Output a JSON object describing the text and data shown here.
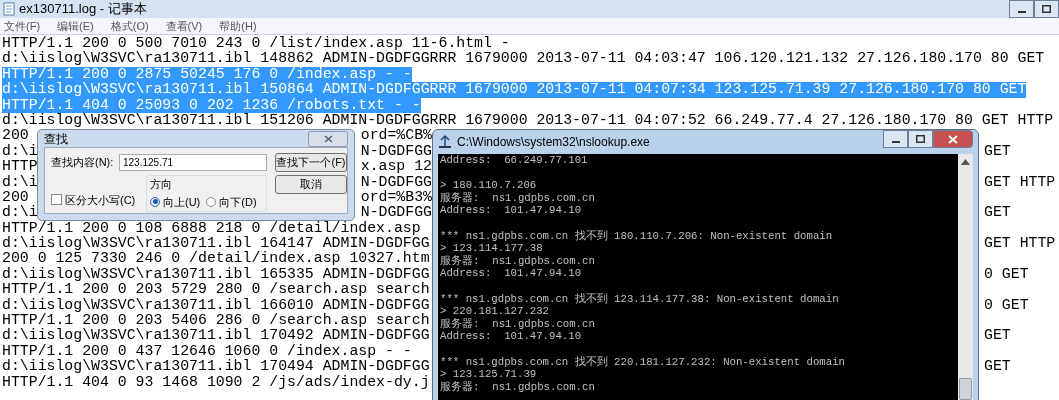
{
  "notepad": {
    "title": "ex130711.log - 记事本",
    "menu": [
      "文件(F)",
      "编辑(E)",
      "格式(O)",
      "查看(V)",
      "帮助(H)"
    ],
    "lines": [
      {
        "text": "HTTP/1.1 200 0 500 7010 243 0 /list/index.asp 11-6.html -",
        "selected": false
      },
      {
        "text": "d:\\iislog\\W3SVC\\ra130711.ibl 148862 ADMIN-DGDFGGRRR 1679000 2013-07-11 04:03:47 106.120.121.132 27.126.180.170 80 GET",
        "selected": false
      },
      {
        "text": "HTTP/1.1 200 0 2875 50245 176 0 /index.asp - -",
        "selected": true
      },
      {
        "text": "d:\\iislog\\W3SVC\\ra130711.ibl 150864 ADMIN-DGDFGGRRR 1679000 2013-07-11 04:07:34 123.125.71.39 27.126.180.170 80 GET",
        "selected": true
      },
      {
        "text": "HTTP/1.1 404 0 25093 0 202 1236 /robots.txt - -",
        "selected": true
      },
      {
        "text": "d:\\iislog\\W3SVC\\ra130711.ibl 151206 ADMIN-DGDFGGRRR 1679000 2013-07-11 04:07:52 66.249.77.4 27.126.180.170 80 GET HTTP",
        "selected": false
      },
      {
        "text": "200",
        "after_dialog": "ord=%CB%",
        "selected": false
      },
      {
        "text": "d:\\i",
        "after_dialog": "N-DGDFGG",
        "after_console": "GET",
        "selected": false
      },
      {
        "text": "HTTP",
        "after_dialog": "x.asp 12",
        "selected": false
      },
      {
        "text": "d:\\i",
        "after_dialog": "N-DGDFGG",
        "after_console": "GET HTTP",
        "selected": false
      },
      {
        "text": "200",
        "after_dialog": "ord=%B3%",
        "selected": false
      },
      {
        "text": "d:\\i",
        "after_dialog": "N-DGDFGG",
        "after_console": "GET",
        "selected": false
      },
      {
        "text": "HTTP/1.1 200 0 108 6888 218 0 /detail/index.asp",
        "selected": false
      },
      {
        "text": "d:\\iislog\\W3SVC\\ra130711.ibl 164147 ADMIN-DGDFGG",
        "after_console": "GET HTTP",
        "selected": false
      },
      {
        "text": "200 0 125 7330 246 0 /detail/index.asp 10327.htm",
        "selected": false
      },
      {
        "text": "d:\\iislog\\W3SVC\\ra130711.ibl 165335 ADMIN-DGDFGG",
        "after_console": "0 GET",
        "selected": false
      },
      {
        "text": "HTTP/1.1 200 0 203 5729 280 0 /search.asp search",
        "selected": false
      },
      {
        "text": "d:\\iislog\\W3SVC\\ra130711.ibl 166010 ADMIN-DGDFGG",
        "after_console": "0 GET",
        "selected": false
      },
      {
        "text": "HTTP/1.1 200 0 203 5406 286 0 /search.asp search",
        "selected": false
      },
      {
        "text": "d:\\iislog\\W3SVC\\ra130711.ibl 170492 ADMIN-DGDFGG",
        "after_console": "GET",
        "selected": false
      },
      {
        "text": "HTTP/1.1 200 0 437 12646 1060 0 /index.asp - -",
        "selected": false
      },
      {
        "text": "d:\\iislog\\W3SVC\\ra130711.ibl 170494 ADMIN-DGDFGG",
        "after_console": "GET",
        "selected": false
      },
      {
        "text": "HTTP/1.1 404 0 93 1468 1090 2 /js/ads/index-dy.j",
        "selected": false
      }
    ]
  },
  "find_dialog": {
    "title": "查找",
    "find_label": "查找内容(N):",
    "find_value": "123.125.71",
    "find_next": "查找下一个(F)",
    "cancel": "取消",
    "match_case": {
      "label": "区分大小写(C)",
      "checked": false
    },
    "direction": {
      "label": "方向",
      "options": [
        {
          "label": "向上(U)",
          "selected": true
        },
        {
          "label": "向下(D)",
          "selected": false
        }
      ]
    }
  },
  "console": {
    "title": "C:\\Windows\\system32\\nslookup.exe",
    "blocks": [
      [
        "Address:  66.249.77.101"
      ],
      [
        "> 180.110.7.206",
        "服务器:  ns1.gdpbs.com.cn",
        "Address:  101.47.94.10"
      ],
      [
        "*** ns1.gdpbs.com.cn 找不到 180.110.7.206: Non-existent domain",
        "> 123.114.177.38",
        "服务器:  ns1.gdpbs.com.cn",
        "Address:  101.47.94.10"
      ],
      [
        "*** ns1.gdpbs.com.cn 找不到 123.114.177.38: Non-existent domain",
        "> 220.181.127.232",
        "服务器:  ns1.gdpbs.com.cn",
        "Address:  101.47.94.10"
      ],
      [
        "*** ns1.gdpbs.com.cn 找不到 220.181.127.232: Non-existent domain",
        "> 123.125.71.39",
        "服务器:  ns1.gdpbs.com.cn"
      ]
    ]
  }
}
